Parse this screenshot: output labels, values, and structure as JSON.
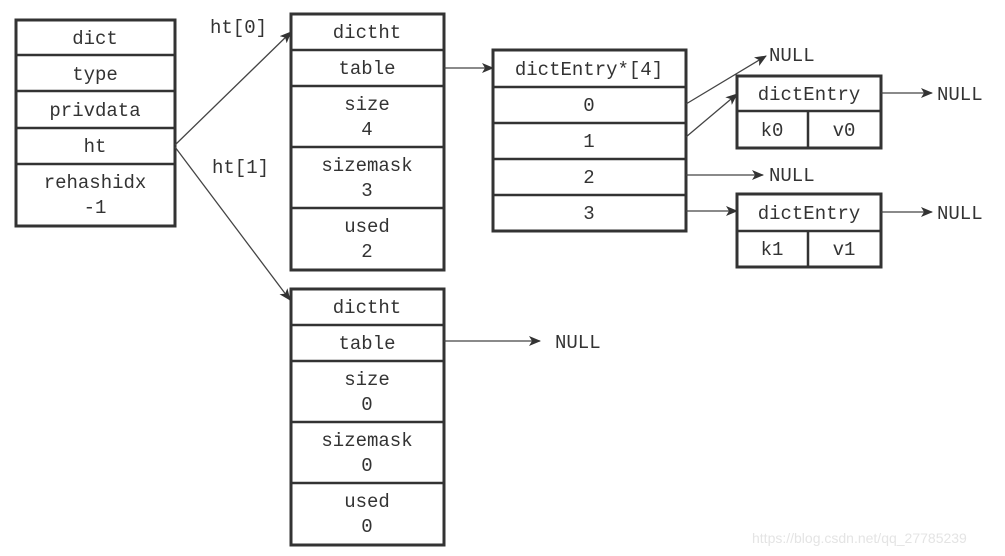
{
  "dict": {
    "title": "dict",
    "fields": [
      "type",
      "privdata",
      "ht"
    ],
    "rehashidx_label": "rehashidx",
    "rehashidx_value": "-1"
  },
  "labels": {
    "ht0": "ht[0]",
    "ht1": "ht[1]"
  },
  "ht0": {
    "title": "dictht",
    "table": "table",
    "size_label": "size",
    "size": "4",
    "sizemask_label": "sizemask",
    "sizemask": "3",
    "used_label": "used",
    "used": "2"
  },
  "ht1": {
    "title": "dictht",
    "table": "table",
    "size_label": "size",
    "size": "0",
    "sizemask_label": "sizemask",
    "sizemask": "0",
    "used_label": "used",
    "used": "0",
    "table_target": "NULL"
  },
  "array": {
    "title": "dictEntry*[4]",
    "slots": [
      "0",
      "1",
      "2",
      "3"
    ]
  },
  "entries": [
    {
      "title": "dictEntry",
      "key": "k0",
      "value": "v0",
      "next": "NULL"
    },
    {
      "title": "dictEntry",
      "key": "k1",
      "value": "v1",
      "next": "NULL"
    }
  ],
  "nulls": {
    "slot0": "NULL",
    "slot2": "NULL"
  },
  "watermark": "https://blog.csdn.net/qq_27785239"
}
